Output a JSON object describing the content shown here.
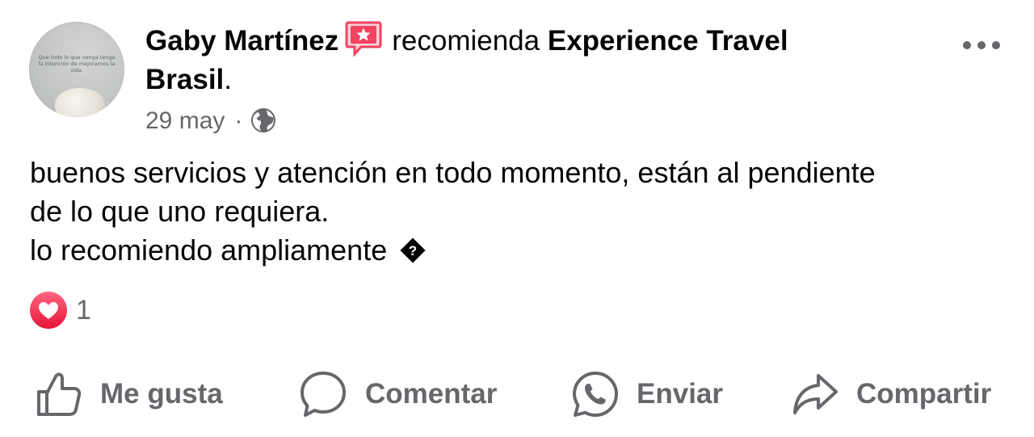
{
  "post": {
    "author": "Gaby Martínez",
    "verb": "recomienda",
    "page_name_line1": "Experience Travel",
    "page_name_line2": "Brasil",
    "period": ".",
    "date": "29 may",
    "separator": "·",
    "audience_icon": "globe-icon",
    "avatar_caption": "Que todo lo que venga tenga la intención de mejorarnos la vida.",
    "body_line1": "buenos servicios y atención en todo momento, están al pendiente",
    "body_line2": "de lo que uno requiera.",
    "body_line3": "lo recomiendo ampliamente",
    "unknown_glyph": "?"
  },
  "reactions": {
    "icon": "love-reaction-icon",
    "count": "1"
  },
  "actions": {
    "like": "Me gusta",
    "comment": "Comentar",
    "send": "Enviar",
    "share": "Compartir"
  },
  "colors": {
    "text": "#050505",
    "secondary": "#65676b",
    "recommend_badge": "#f3425f",
    "love": "#f33e58"
  }
}
